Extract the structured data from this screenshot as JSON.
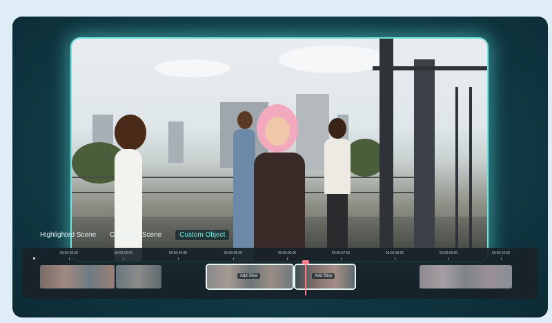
{
  "scene_tabs": [
    "Highlighted Scene",
    "Character Scene",
    "Custom Object"
  ],
  "active_tab": "Custom Object",
  "timeline": {
    "timestamps": [
      "00:00:02:00",
      "00:00:03:00",
      "00:00:04:00",
      "00:00:05:00",
      "00:00:06:00",
      "00:00:07:00",
      "00:00:08:00",
      "00:00:09:00",
      "00:00:10:00"
    ],
    "add_slice_labels": [
      "Add Slice",
      "Add Slice"
    ]
  },
  "colors": {
    "accent": "#6ff0e6",
    "playhead": "#ff7c8c",
    "frame_glow": "#6fe3df"
  }
}
